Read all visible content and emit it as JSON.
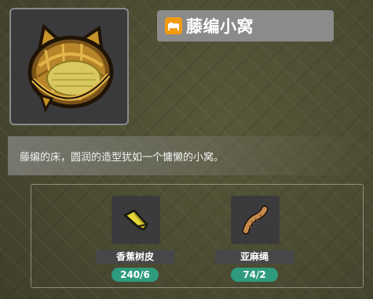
{
  "item": {
    "name": "藤编小窝",
    "title_icon": "bed-icon",
    "image_icon": "rattan-bed-icon",
    "description": "藤编的床，圆润的造型犹如一个慵懒的小窝。"
  },
  "materials": [
    {
      "name": "香蕉树皮",
      "count": "240/6",
      "icon": "banana-bark-icon"
    },
    {
      "name": "亚麻绳",
      "count": "74/2",
      "icon": "flax-rope-icon"
    }
  ],
  "colors": {
    "title_icon_bg": "#f09b12",
    "count_badge_bg": "#2e9b7e",
    "title_bar_bg": "#8b8b8b"
  }
}
